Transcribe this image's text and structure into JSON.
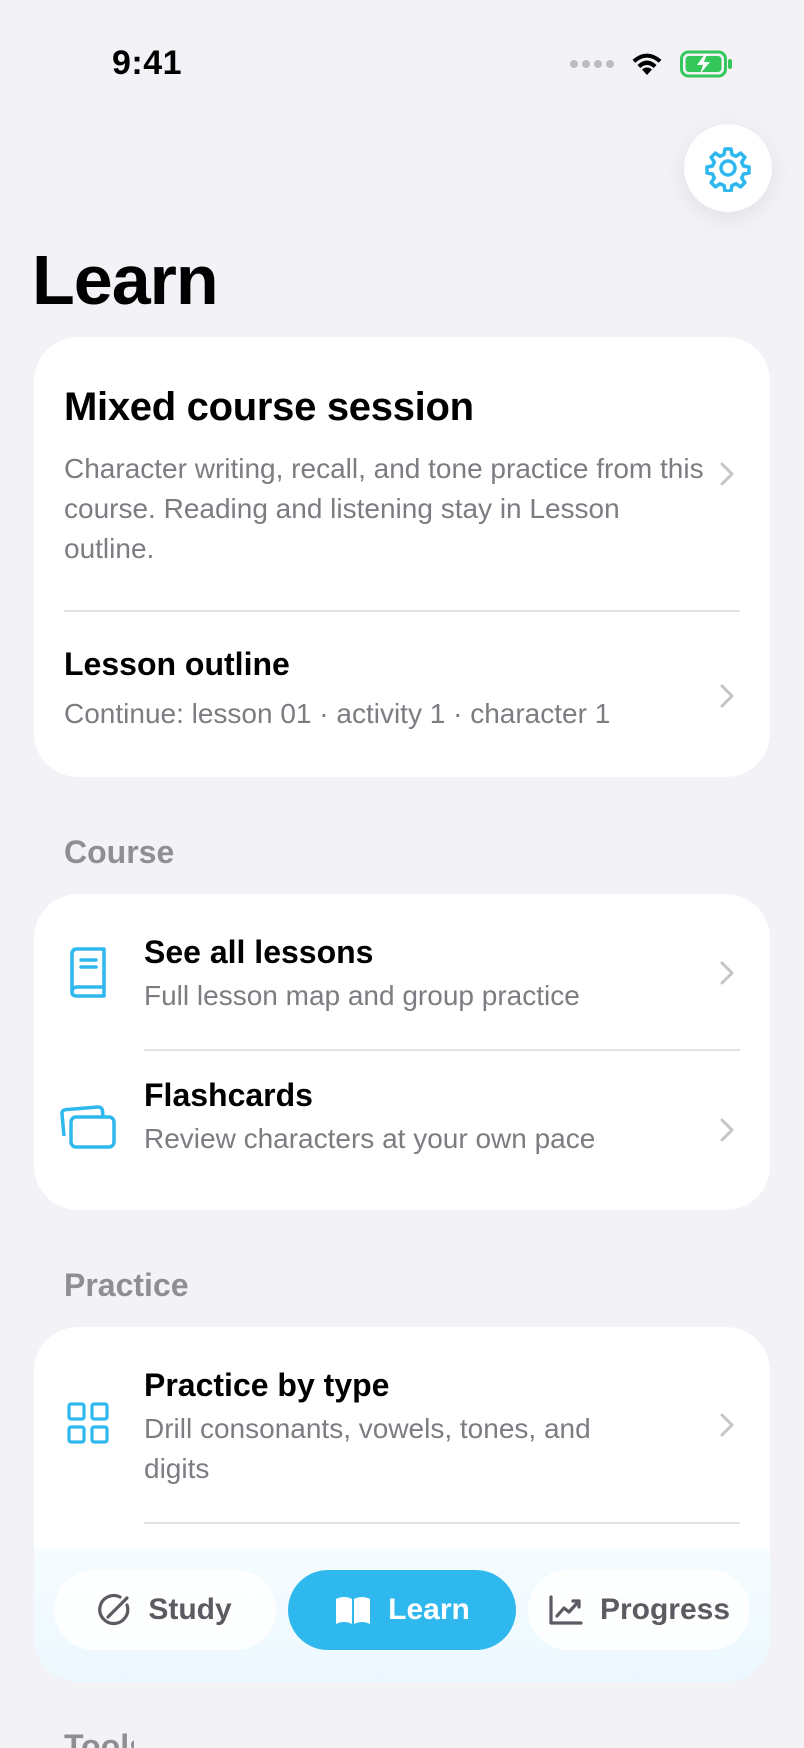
{
  "status_bar": {
    "time": "9:41",
    "battery_color": "#34C759",
    "icons": [
      "cellular-icon",
      "wifi-icon",
      "battery-charging-icon"
    ]
  },
  "header": {
    "title": "Learn",
    "settings_icon": "gear-icon"
  },
  "colors": {
    "accent": "#2FB8EE",
    "background": "#F2F2F7",
    "card": "#FFFFFF",
    "secondary_text": "#7C7C82",
    "section_label": "#8E8E93"
  },
  "hero_card": {
    "session": {
      "title": "Mixed course session",
      "description": "Character writing, recall, and tone practice from this course. Reading and listening stay in Lesson outline."
    },
    "outline": {
      "title": "Lesson outline",
      "subtitle": "Continue: lesson 01 · activity 1 · character 1"
    }
  },
  "course_section": {
    "label": "Course",
    "items": [
      {
        "icon": "book-icon",
        "title": "See all lessons",
        "subtitle": "Full lesson map and group practice"
      },
      {
        "icon": "cards-icon",
        "title": "Flashcards",
        "subtitle": "Review characters at your own pace"
      }
    ]
  },
  "practice_section": {
    "label": "Practice",
    "items": [
      {
        "icon": "grid-icon",
        "title": "Practice by type",
        "subtitle": "Drill consonants, vowels, tones, and digits"
      }
    ]
  },
  "tab_bar": {
    "selected": "Learn",
    "tabs": [
      {
        "icon": "compass-pencil-icon",
        "label": "Study"
      },
      {
        "icon": "open-book-icon",
        "label": "Learn"
      },
      {
        "icon": "chart-trend-icon",
        "label": "Progress"
      }
    ]
  },
  "next_section_peek": {
    "label": "Tools"
  }
}
